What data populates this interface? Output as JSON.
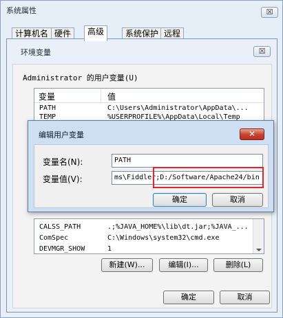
{
  "system_properties": {
    "title": "系统属性",
    "close_label": "☒",
    "tabs": [
      {
        "label": "计算机名"
      },
      {
        "label": "硬件"
      },
      {
        "label": "高级"
      },
      {
        "label": "系统保护"
      },
      {
        "label": "远程"
      }
    ],
    "active_tab": "高级"
  },
  "env_vars": {
    "title": "环境变量",
    "close_label": "☒",
    "user_group_label": "Administrator 的用户变量(U)",
    "column_var": "变量",
    "column_value": "值",
    "user_vars": [
      {
        "name": "PATH",
        "value": "C:\\Users\\Administrator\\AppData\\..."
      },
      {
        "name": "TEMP",
        "value": "%USERPROFILE%\\AppData\\Local\\Temp"
      }
    ],
    "system_vars": [
      {
        "name": "CALSS_PATH",
        "value": ".;%JAVA_HOME%\\lib\\dt.jar;%JAVA_..."
      },
      {
        "name": "ComSpec",
        "value": "C:\\Windows\\system32\\cmd.exe"
      },
      {
        "name": "DEVMGR_SHOW",
        "value": "1"
      }
    ],
    "buttons": {
      "new": "新建(W)...",
      "edit": "编辑(I)...",
      "delete": "删除(L)"
    },
    "ok": "确定",
    "cancel": "取消"
  },
  "edit_dialog": {
    "title": "编辑用户变量",
    "close_label": "✕",
    "name_label": "变量名(N):",
    "value_label": "变量值(V):",
    "name_value": "PATH",
    "value_value": "ms\\Fiddler;D:/Software/Apache24/bin",
    "ok": "确定",
    "cancel": "取消"
  },
  "colors": {
    "highlight": "#e0262b",
    "dialog_title_bg": "#cfdff3",
    "close_red": "#c7402a"
  }
}
